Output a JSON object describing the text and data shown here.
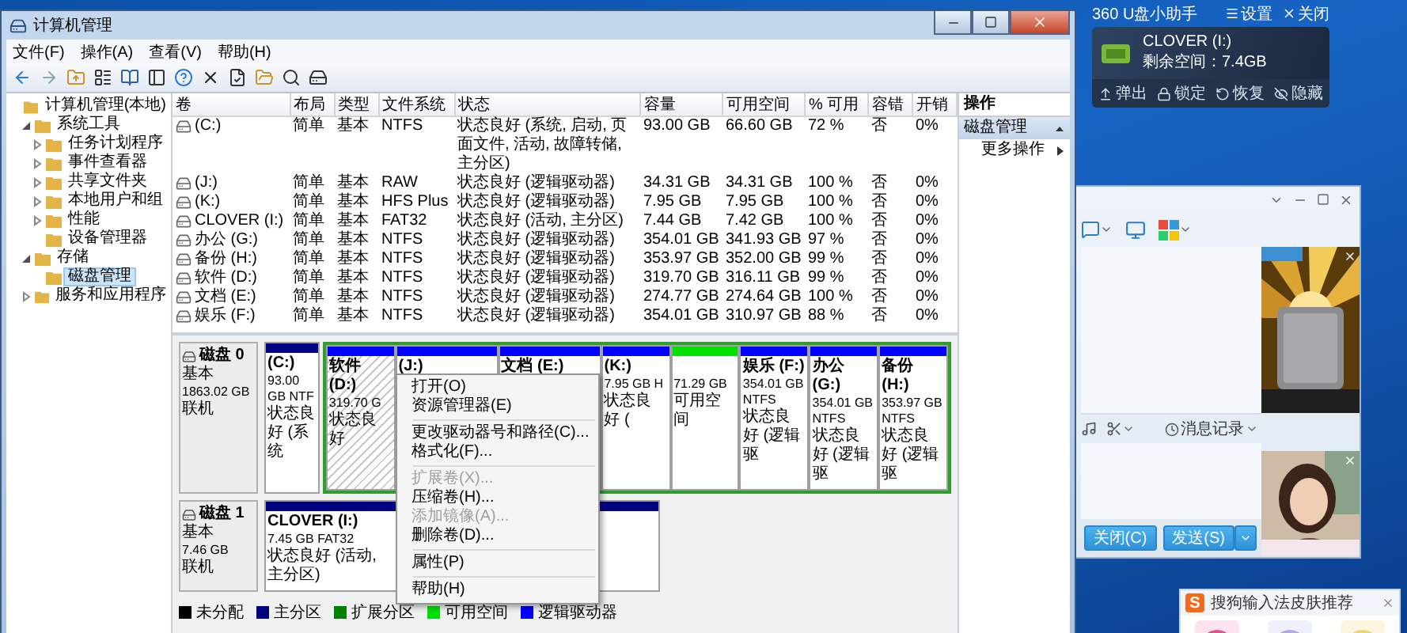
{
  "window": {
    "title": "计算机管理"
  },
  "menu": [
    "文件(F)",
    "操作(A)",
    "查看(V)",
    "帮助(H)"
  ],
  "tree": [
    {
      "label": "计算机管理(本地)",
      "selected": false,
      "children": [
        {
          "label": "系统工具",
          "expanded": true,
          "selected": false,
          "children": [
            {
              "label": "任务计划程序",
              "expanded": false,
              "selected": false
            },
            {
              "label": "事件查看器",
              "expanded": false,
              "selected": false
            },
            {
              "label": "共享文件夹",
              "expanded": false,
              "selected": false
            },
            {
              "label": "本地用户和组",
              "expanded": false,
              "selected": false
            },
            {
              "label": "性能",
              "expanded": false,
              "selected": false
            },
            {
              "label": "设备管理器",
              "selected": false
            }
          ]
        },
        {
          "label": "存储",
          "expanded": true,
          "selected": false,
          "children": [
            {
              "label": "磁盘管理",
              "selected": true
            }
          ]
        },
        {
          "label": "服务和应用程序",
          "expanded": false,
          "selected": false
        }
      ]
    }
  ],
  "volumes": {
    "columns": [
      "卷",
      "布局",
      "类型",
      "文件系统",
      "状态",
      "容量",
      "可用空间",
      "% 可用",
      "容错",
      "开销"
    ],
    "rows": [
      {
        "cells": [
          "(C:)",
          "简单",
          "基本",
          "NTFS",
          "状态良好 (系统, 启动, 页面文件, 活动, 故障转储, 主分区)",
          "93.00 GB",
          "66.60 GB",
          "72 %",
          "否",
          "0%"
        ]
      },
      {
        "cells": [
          "(J:)",
          "简单",
          "基本",
          "RAW",
          "状态良好 (逻辑驱动器)",
          "34.31 GB",
          "34.31 GB",
          "100 %",
          "否",
          "0%"
        ]
      },
      {
        "cells": [
          "(K:)",
          "简单",
          "基本",
          "HFS Plus",
          "状态良好 (逻辑驱动器)",
          "7.95 GB",
          "7.95 GB",
          "100 %",
          "否",
          "0%"
        ]
      },
      {
        "cells": [
          "CLOVER (I:)",
          "简单",
          "基本",
          "FAT32",
          "状态良好 (活动, 主分区)",
          "7.44 GB",
          "7.42 GB",
          "100 %",
          "否",
          "0%"
        ]
      },
      {
        "cells": [
          "办公 (G:)",
          "简单",
          "基本",
          "NTFS",
          "状态良好 (逻辑驱动器)",
          "354.01 GB",
          "341.93 GB",
          "97 %",
          "否",
          "0%"
        ]
      },
      {
        "cells": [
          "备份 (H:)",
          "简单",
          "基本",
          "NTFS",
          "状态良好 (逻辑驱动器)",
          "353.97 GB",
          "352.00 GB",
          "99 %",
          "否",
          "0%"
        ]
      },
      {
        "cells": [
          "软件 (D:)",
          "简单",
          "基本",
          "NTFS",
          "状态良好 (逻辑驱动器)",
          "319.70 GB",
          "316.11 GB",
          "99 %",
          "否",
          "0%"
        ]
      },
      {
        "cells": [
          "文档 (E:)",
          "简单",
          "基本",
          "NTFS",
          "状态良好 (逻辑驱动器)",
          "274.77 GB",
          "274.64 GB",
          "100 %",
          "否",
          "0%"
        ]
      },
      {
        "cells": [
          "娱乐 (F:)",
          "简单",
          "基本",
          "NTFS",
          "状态良好 (逻辑驱动器)",
          "354.01 GB",
          "310.97 GB",
          "88 %",
          "否",
          "0%"
        ]
      }
    ]
  },
  "disks": [
    {
      "label": "磁盘 0",
      "type": "基本",
      "size": "1863.02 GB",
      "status": "联机",
      "partitions": [
        {
          "kind": "primary",
          "name": "(C:)",
          "size": "93.00 GB NTF",
          "status": "状态良好 (系统",
          "selected": false
        },
        {
          "kind": "extended",
          "children": [
            {
              "kind": "logical",
              "name": "软件 (D:)",
              "size": "319.70 G",
              "status": "状态良好",
              "selected": true
            },
            {
              "kind": "logical",
              "name": "(J:)",
              "selected": false
            },
            {
              "kind": "logical",
              "name": "文档 (E:)",
              "selected": false
            },
            {
              "kind": "logical",
              "name": "(K:)",
              "size": "7.95 GB H",
              "status": "状态良好 (",
              "selected": false
            },
            {
              "kind": "free",
              "size": "71.29 GB",
              "status": "可用空间",
              "selected": false
            },
            {
              "kind": "logical",
              "name": "娱乐 (F:)",
              "size": "354.01 GB NTFS",
              "status": "状态良好 (逻辑驱",
              "selected": false
            },
            {
              "kind": "logical",
              "name": "办公 (G:)",
              "size": "354.01 GB NTFS",
              "status": "状态良好 (逻辑驱",
              "selected": false
            },
            {
              "kind": "logical",
              "name": "备份 (H:)",
              "size": "353.97 GB NTFS",
              "status": "状态良好 (逻辑驱",
              "selected": false
            }
          ]
        }
      ]
    },
    {
      "label": "磁盘 1",
      "type": "基本",
      "size": "7.46 GB",
      "status": "联机",
      "partitions": [
        {
          "kind": "primary",
          "name": "CLOVER (I:)",
          "size": "7.45 GB FAT32",
          "status": "状态良好 (活动, 主分区)",
          "selected": false
        }
      ]
    }
  ],
  "context_menu": [
    {
      "kind": "item",
      "label": "打开(O)",
      "disabled": false
    },
    {
      "kind": "item",
      "label": "资源管理器(E)",
      "disabled": false
    },
    {
      "kind": "separator"
    },
    {
      "kind": "item",
      "label": "更改驱动器号和路径(C)...",
      "disabled": false
    },
    {
      "kind": "item",
      "label": "格式化(F)...",
      "disabled": false
    },
    {
      "kind": "separator"
    },
    {
      "kind": "item",
      "label": "扩展卷(X)...",
      "disabled": true
    },
    {
      "kind": "item",
      "label": "压缩卷(H)...",
      "disabled": false
    },
    {
      "kind": "item",
      "label": "添加镜像(A)...",
      "disabled": true
    },
    {
      "kind": "item",
      "label": "删除卷(D)...",
      "disabled": false
    },
    {
      "kind": "separator"
    },
    {
      "kind": "item",
      "label": "属性(P)",
      "disabled": false
    },
    {
      "kind": "separator"
    },
    {
      "kind": "item",
      "label": "帮助(H)",
      "disabled": false
    }
  ],
  "legend": [
    {
      "label": "未分配",
      "color": "#000000"
    },
    {
      "label": "主分区",
      "color": "#000080"
    },
    {
      "label": "扩展分区",
      "color": "#008000"
    },
    {
      "label": "可用空间",
      "color": "#00e000"
    },
    {
      "label": "逻辑驱动器",
      "color": "#0000ff"
    }
  ],
  "actions": {
    "title": "操作",
    "section": {
      "label": "磁盘管理",
      "expanded": true
    },
    "items": [
      {
        "label": "更多操作"
      }
    ]
  },
  "usb_helper": {
    "title": "360 U盘小助手",
    "settings": "设置",
    "close": "关闭",
    "drive": "CLOVER (I:)",
    "free_space": "剩余空间：7.4GB",
    "actions": [
      {
        "kind": "eject",
        "label": "弹出"
      },
      {
        "kind": "lock",
        "label": "锁定"
      },
      {
        "kind": "restore",
        "label": "恢复"
      },
      {
        "kind": "hide",
        "label": "隐藏"
      }
    ]
  },
  "chat": {
    "history": "消息记录",
    "buttons": [
      {
        "kind": "close",
        "label": "关闭(C)"
      },
      {
        "kind": "send",
        "label": "发送(S)"
      }
    ]
  },
  "ime_popup": {
    "logo": "S",
    "title": "搜狗输入法皮肤推荐"
  }
}
